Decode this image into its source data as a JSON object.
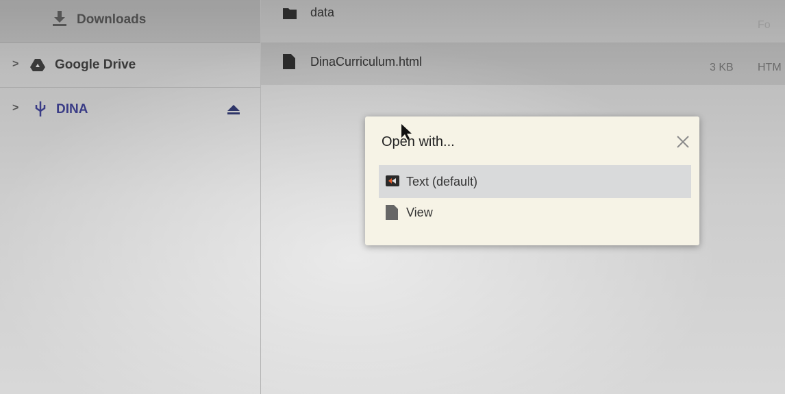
{
  "sidebar": {
    "items": [
      {
        "label": "Downloads",
        "icon": "download-icon"
      },
      {
        "label": "Google Drive",
        "icon": "google-drive-icon",
        "expand": ">"
      },
      {
        "label": "DINA",
        "icon": "usb-icon",
        "expand": ">",
        "action_icon": "eject-icon"
      }
    ]
  },
  "files": [
    {
      "name": "data",
      "icon": "folder-icon",
      "type": "Fo"
    },
    {
      "name": "DinaCurriculum.html",
      "icon": "file-icon",
      "size": "3 KB",
      "type": "HTM"
    }
  ],
  "dialog": {
    "title": "Open with...",
    "close_icon": "close-icon",
    "options": [
      {
        "label": "Text (default)",
        "icon": "text-app-icon",
        "selected": true
      },
      {
        "label": "View",
        "icon": "file-icon",
        "selected": false
      }
    ]
  },
  "colors": {
    "dialog_bg": "#f6f3e6",
    "selected_bg": "#d9dadb",
    "usb_label": "#3a3c86"
  }
}
